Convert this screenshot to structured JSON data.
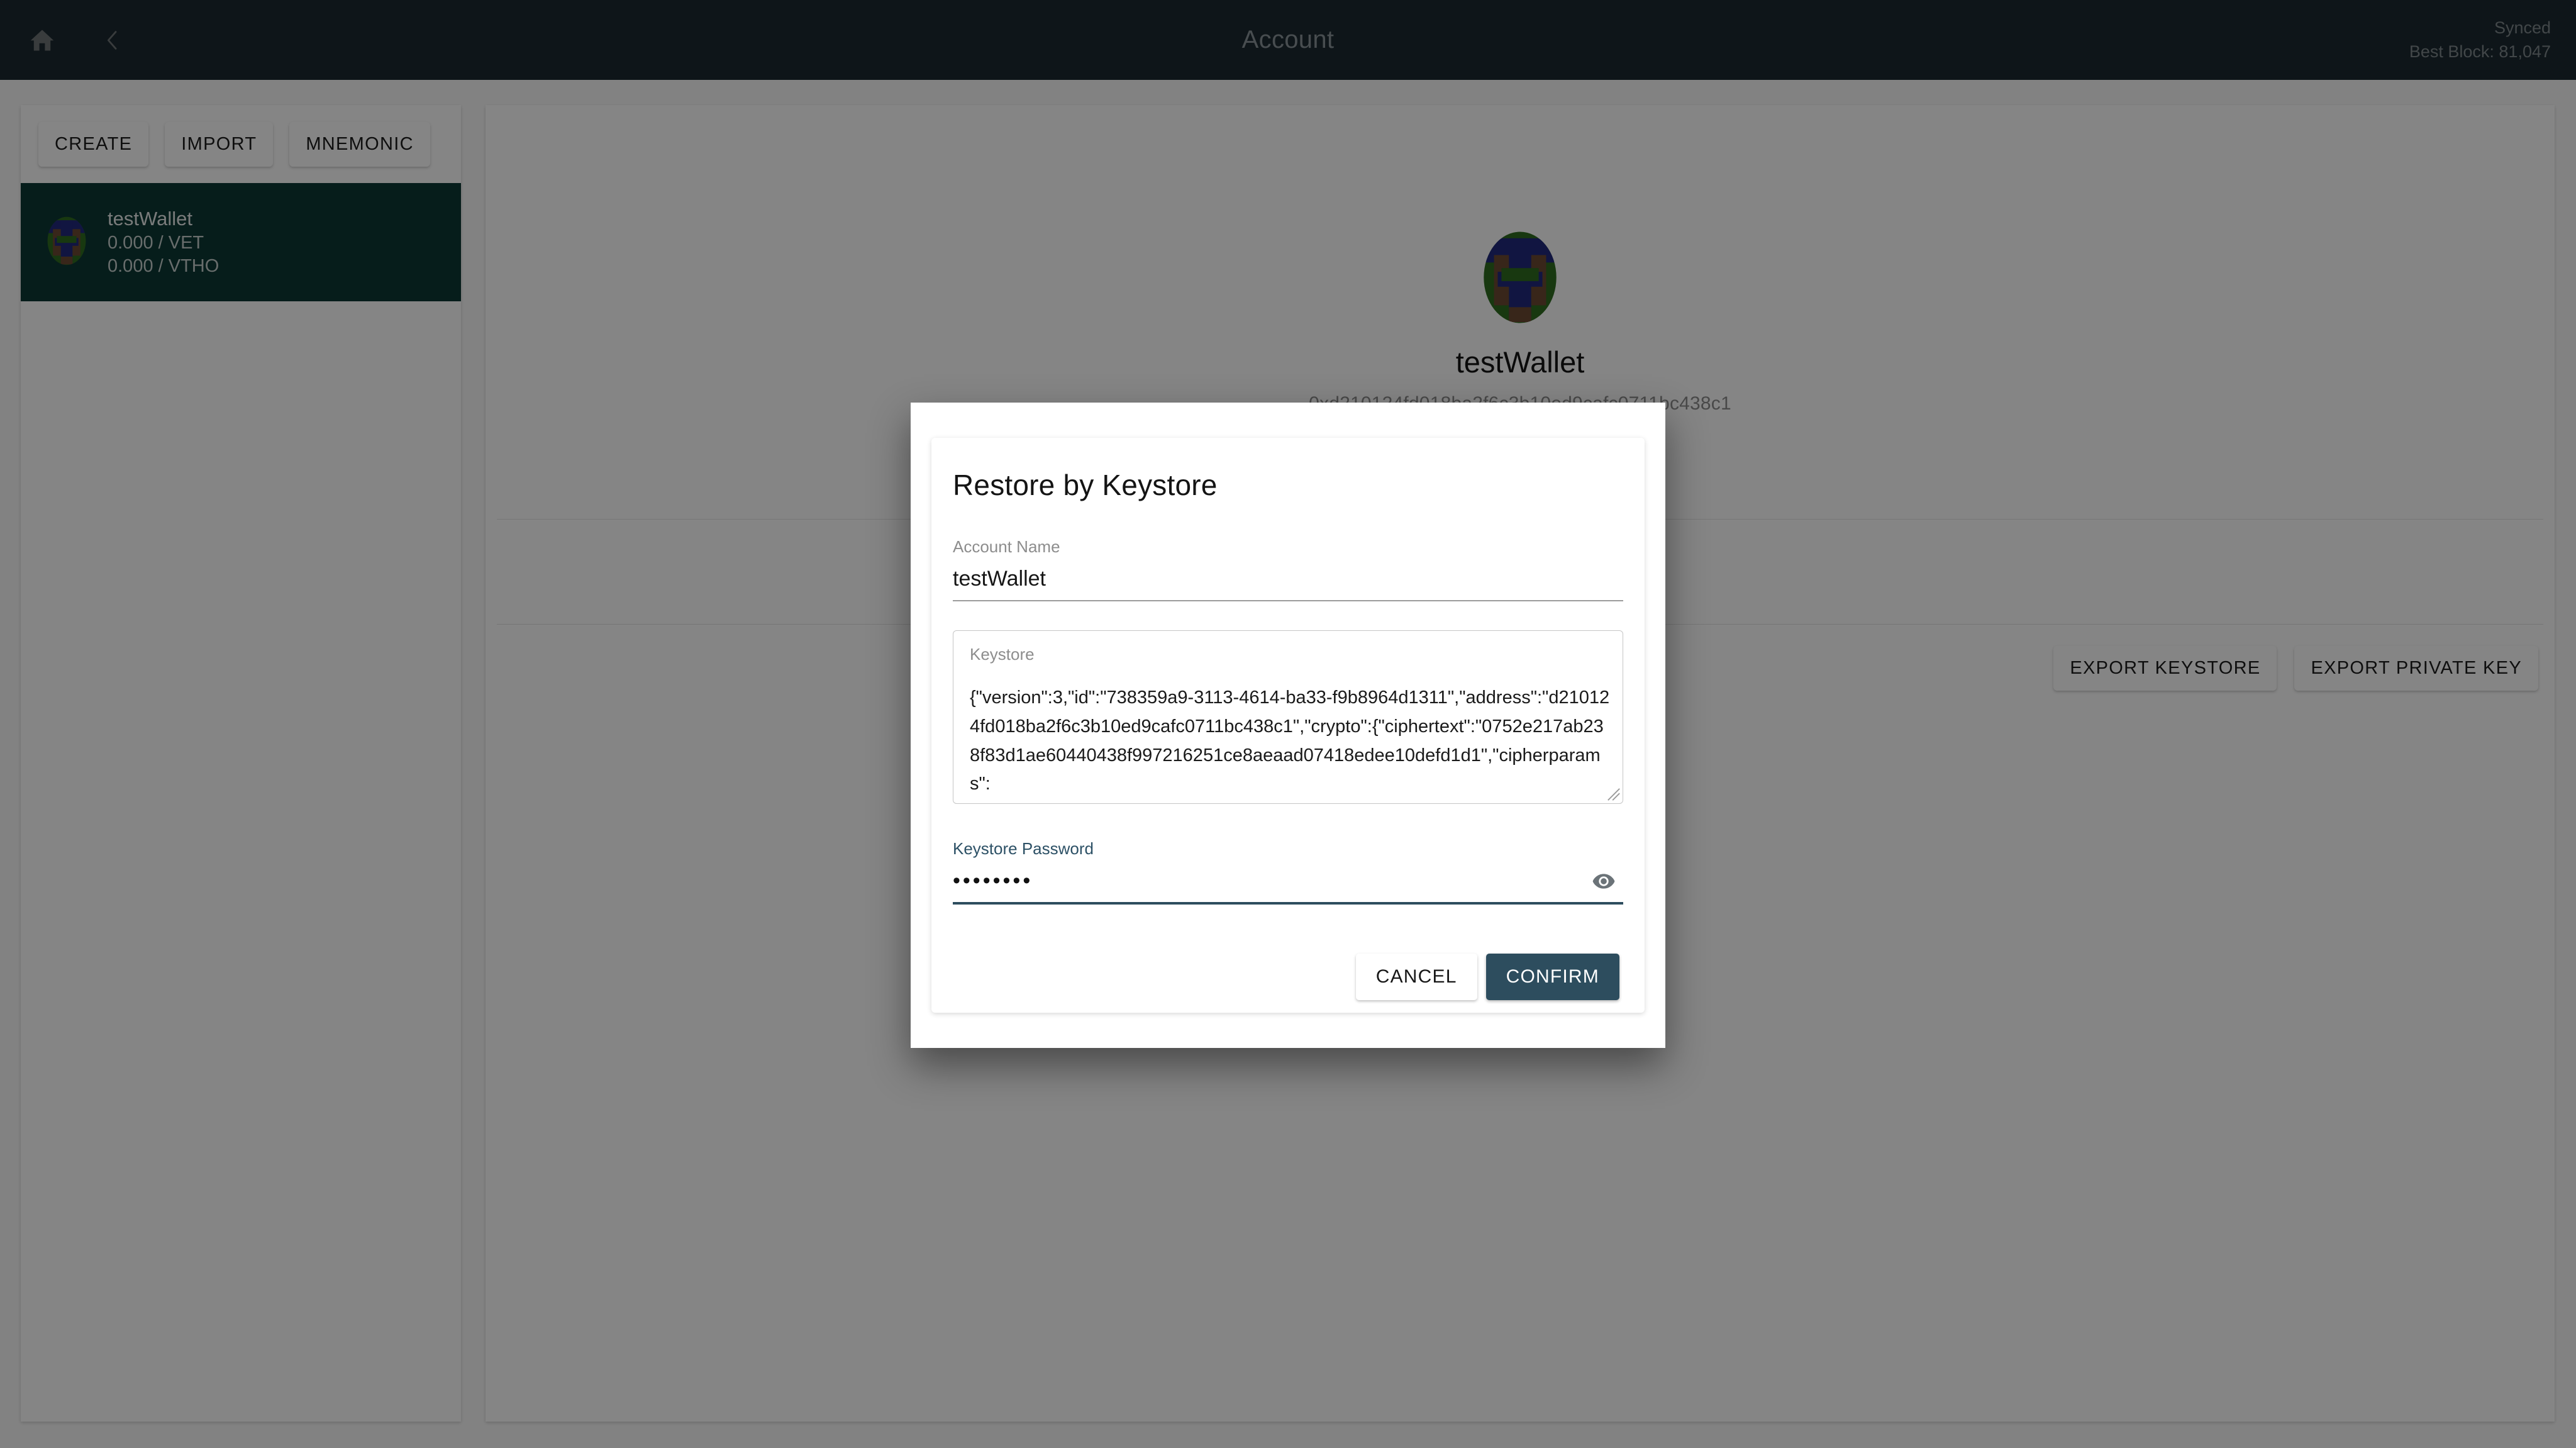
{
  "header": {
    "title": "Account",
    "home_icon": "home-icon",
    "back_icon": "chevron-left-icon",
    "sync_status": "Synced",
    "best_block": "Best Block: 81,047"
  },
  "sidebar": {
    "actions": [
      {
        "label": "CREATE"
      },
      {
        "label": "IMPORT"
      },
      {
        "label": "MNEMONIC"
      }
    ],
    "wallets": [
      {
        "name": "testWallet",
        "vet": "0.000 / VET",
        "vtho": "0.000 / VTHO",
        "selected_bg": "#0d3934"
      }
    ]
  },
  "account": {
    "name": "testWallet",
    "address": "0xd210124fd018ba2f6c3b10ed9cafc0711bc438c1",
    "actions": [
      {
        "label": "EXPORT KEYSTORE"
      },
      {
        "label": "EXPORT PRIVATE KEY"
      }
    ]
  },
  "modal": {
    "title": "Restore by Keystore",
    "account_name": {
      "label": "Account Name",
      "value": "testWallet"
    },
    "keystore": {
      "label": "Keystore",
      "value": "{\"version\":3,\"id\":\"738359a9-3113-4614-ba33-f9b8964d1311\",\"address\":\"d210124fd018ba2f6c3b10ed9cafc0711bc438c1\",\"crypto\":{\"ciphertext\":\"0752e217ab238f83d1ae60440438f997216251ce8aeaad07418edee10defd1d1\",\"cipherparams\":"
    },
    "password": {
      "label": "Keystore Password",
      "value": "••••••••",
      "masked_char_count": 8,
      "reveal_icon": "eye-icon"
    },
    "cancel_label": "CANCEL",
    "confirm_label": "CONFIRM"
  },
  "colors": {
    "header_bg": "#1b2a30",
    "accent": "#2d4d5e",
    "selected_wallet": "#0d3934",
    "scrim": "rgba(0,0,0,0.48)"
  }
}
